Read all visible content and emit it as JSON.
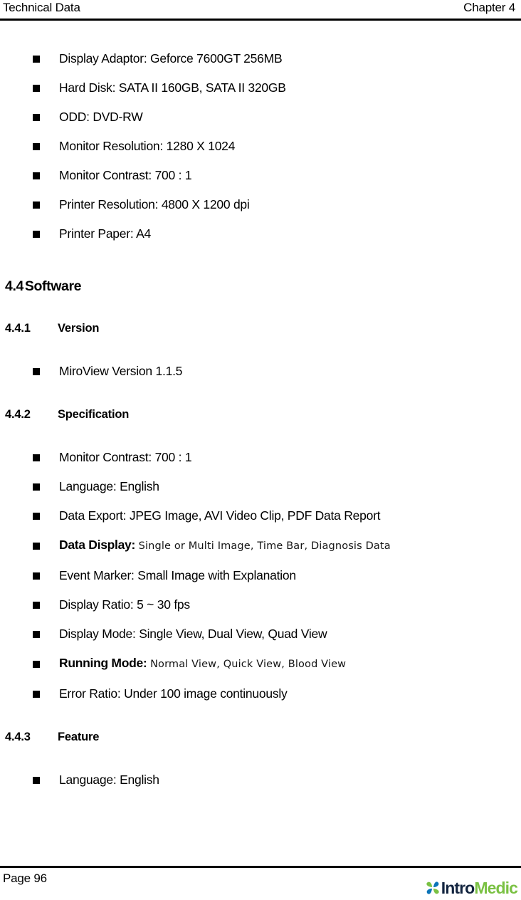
{
  "header": {
    "left_title": "Technical Data",
    "right_title": "Chapter 4"
  },
  "hardware_bullets": [
    {
      "text": "Display Adaptor: Geforce 7600GT 256MB"
    },
    {
      "text": "Hard Disk: SATA II 160GB, SATA II 320GB"
    },
    {
      "text": "ODD: DVD-RW"
    },
    {
      "text": "Monitor Resolution: 1280 X 1024"
    },
    {
      "text": "Monitor Contrast: 700 : 1"
    },
    {
      "text": "Printer Resolution: 4800 X 1200 dpi"
    },
    {
      "text": "Printer Paper: A4"
    }
  ],
  "section_software": {
    "number": "4.4",
    "title": "Software"
  },
  "subsection_version": {
    "number": "4.4.1",
    "title": "Version",
    "bullets": [
      {
        "text": "MiroView Version 1.1.5"
      }
    ]
  },
  "subsection_specification": {
    "number": "4.4.2",
    "title": "Specification",
    "bullets": [
      {
        "text": "Monitor Contrast: 700 : 1"
      },
      {
        "text": "Language: English"
      },
      {
        "text": "Data Export: JPEG Image, AVI Video Clip, PDF Data Report"
      },
      {
        "label": "Data Display:",
        "value": "Single or Multi Image, Time Bar, Diagnosis Data"
      },
      {
        "text": "Event Marker: Small Image with Explanation"
      },
      {
        "text": "Display Ratio: 5 ~ 30 fps"
      },
      {
        "text": "Display Mode: Single View, Dual View, Quad View"
      },
      {
        "label": "Running Mode:",
        "value": "Normal View, Quick View, Blood View"
      },
      {
        "text": "Error Ratio: Under 100 image continuously"
      }
    ]
  },
  "subsection_feature": {
    "number": "4.4.3",
    "title": "Feature",
    "bullets": [
      {
        "text": "Language: English"
      }
    ]
  },
  "footer": {
    "page_label": "Page 96",
    "logo_part1": "Intro",
    "logo_part2": "Medic",
    "logo_color_green": "#7ac143",
    "logo_color_blue": "#0b74b8",
    "logo_color_dark": "#12243f"
  }
}
